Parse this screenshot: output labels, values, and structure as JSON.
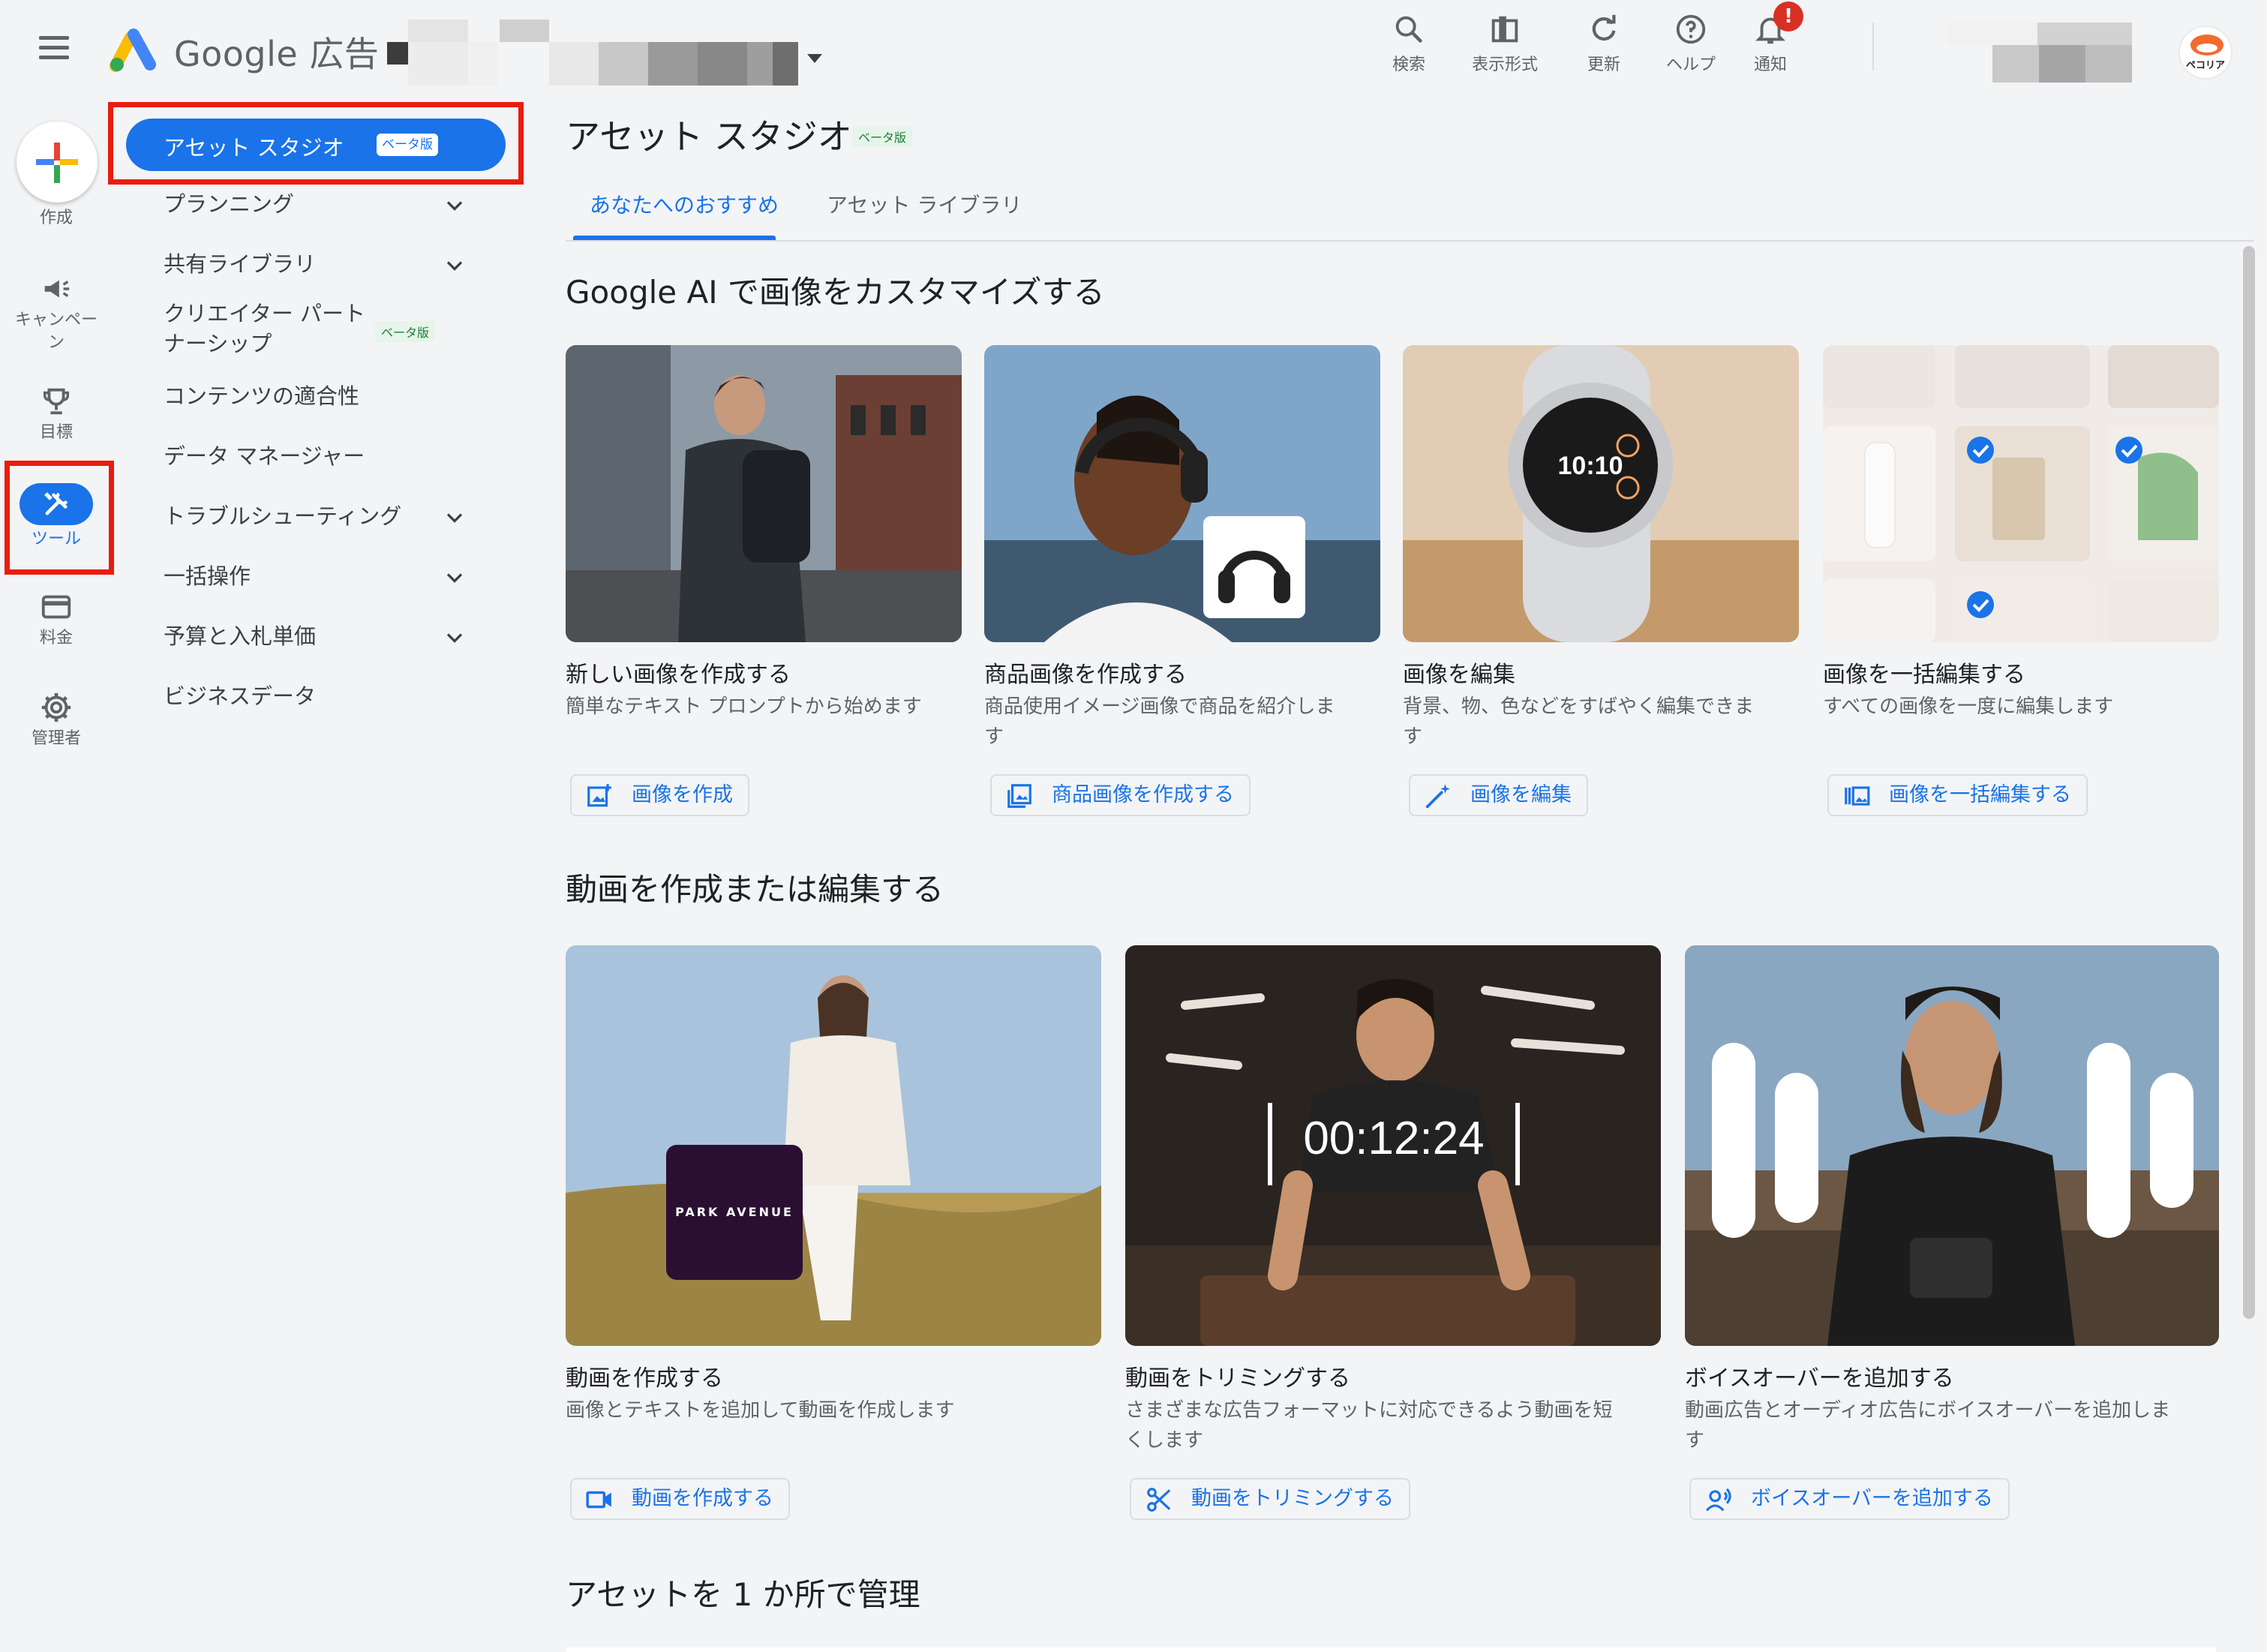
{
  "header": {
    "logo_text": "Google 広告",
    "toolbar": [
      {
        "label": "検索",
        "icon": "search-icon"
      },
      {
        "label": "表示形式",
        "icon": "appearance-icon"
      },
      {
        "label": "更新",
        "icon": "refresh-icon"
      },
      {
        "label": "ヘルプ",
        "icon": "help-icon"
      },
      {
        "label": "通知",
        "icon": "bell-icon"
      }
    ],
    "notification_badge": "!",
    "avatar_text": "ペコリア"
  },
  "rail": {
    "create": "作成",
    "campaigns": "キャンペーン",
    "goals": "目標",
    "tools": "ツール",
    "billing": "料金",
    "admin": "管理者"
  },
  "sidenav": {
    "active": {
      "label": "アセット スタジオ",
      "badge": "ベータ版"
    },
    "items": [
      {
        "label": "プランニング",
        "expandable": true
      },
      {
        "label": "共有ライブラリ",
        "expandable": true
      },
      {
        "label": "クリエイター パート\nナーシップ",
        "expandable": false,
        "badge": "ベータ版"
      },
      {
        "label": "コンテンツの適合性",
        "expandable": false
      },
      {
        "label": "データ マネージャー",
        "expandable": false
      },
      {
        "label": "トラブルシューティング",
        "expandable": true
      },
      {
        "label": "一括操作",
        "expandable": true
      },
      {
        "label": "予算と入札単価",
        "expandable": true
      },
      {
        "label": "ビジネスデータ",
        "expandable": false
      }
    ]
  },
  "main": {
    "title": "アセット スタジオ",
    "title_badge": "ベータ版",
    "tabs": [
      {
        "label": "あなたへのおすすめ",
        "selected": true
      },
      {
        "label": "アセット ライブラリ",
        "selected": false
      }
    ],
    "section_image": {
      "title": "Google AI で画像をカスタマイズする",
      "cards": [
        {
          "title": "新しい画像を作成する",
          "desc": "簡単なテキスト プロンプトから始めます",
          "button": "画像を作成"
        },
        {
          "title": "商品画像を作成する",
          "desc": "商品使用イメージ画像で商品を紹介しま\nす",
          "button": "商品画像を作成する"
        },
        {
          "title": "画像を編集",
          "desc": "背景、物、色などをすばやく編集できま\nす",
          "button": "画像を編集"
        },
        {
          "title": "画像を一括編集する",
          "desc": "すべての画像を一度に編集します",
          "button": "画像を一括編集する"
        }
      ]
    },
    "section_video": {
      "title": "動画を作成または編集する",
      "cards": [
        {
          "title": "動画を作成する",
          "desc": "画像とテキストを追加して動画を作成します",
          "button": "動画を作成する",
          "overlay": "PARK AVENUE"
        },
        {
          "title": "動画をトリミングする",
          "desc": "さまざまな広告フォーマットに対応できるよう動画を短\nくします",
          "button": "動画をトリミングする",
          "overlay": "00:12:24"
        },
        {
          "title": "ボイスオーバーを追加する",
          "desc": "動画広告とオーディオ広告にボイスオーバーを追加しま\nす",
          "button": "ボイスオーバーを追加する"
        }
      ]
    },
    "section_manage": {
      "title": "アセットを 1 か所で管理"
    }
  },
  "colors": {
    "accent": "#1a73e8",
    "highlight": "#ea1c0d",
    "beta_green": "#188038",
    "background": "#f3f4f6"
  }
}
